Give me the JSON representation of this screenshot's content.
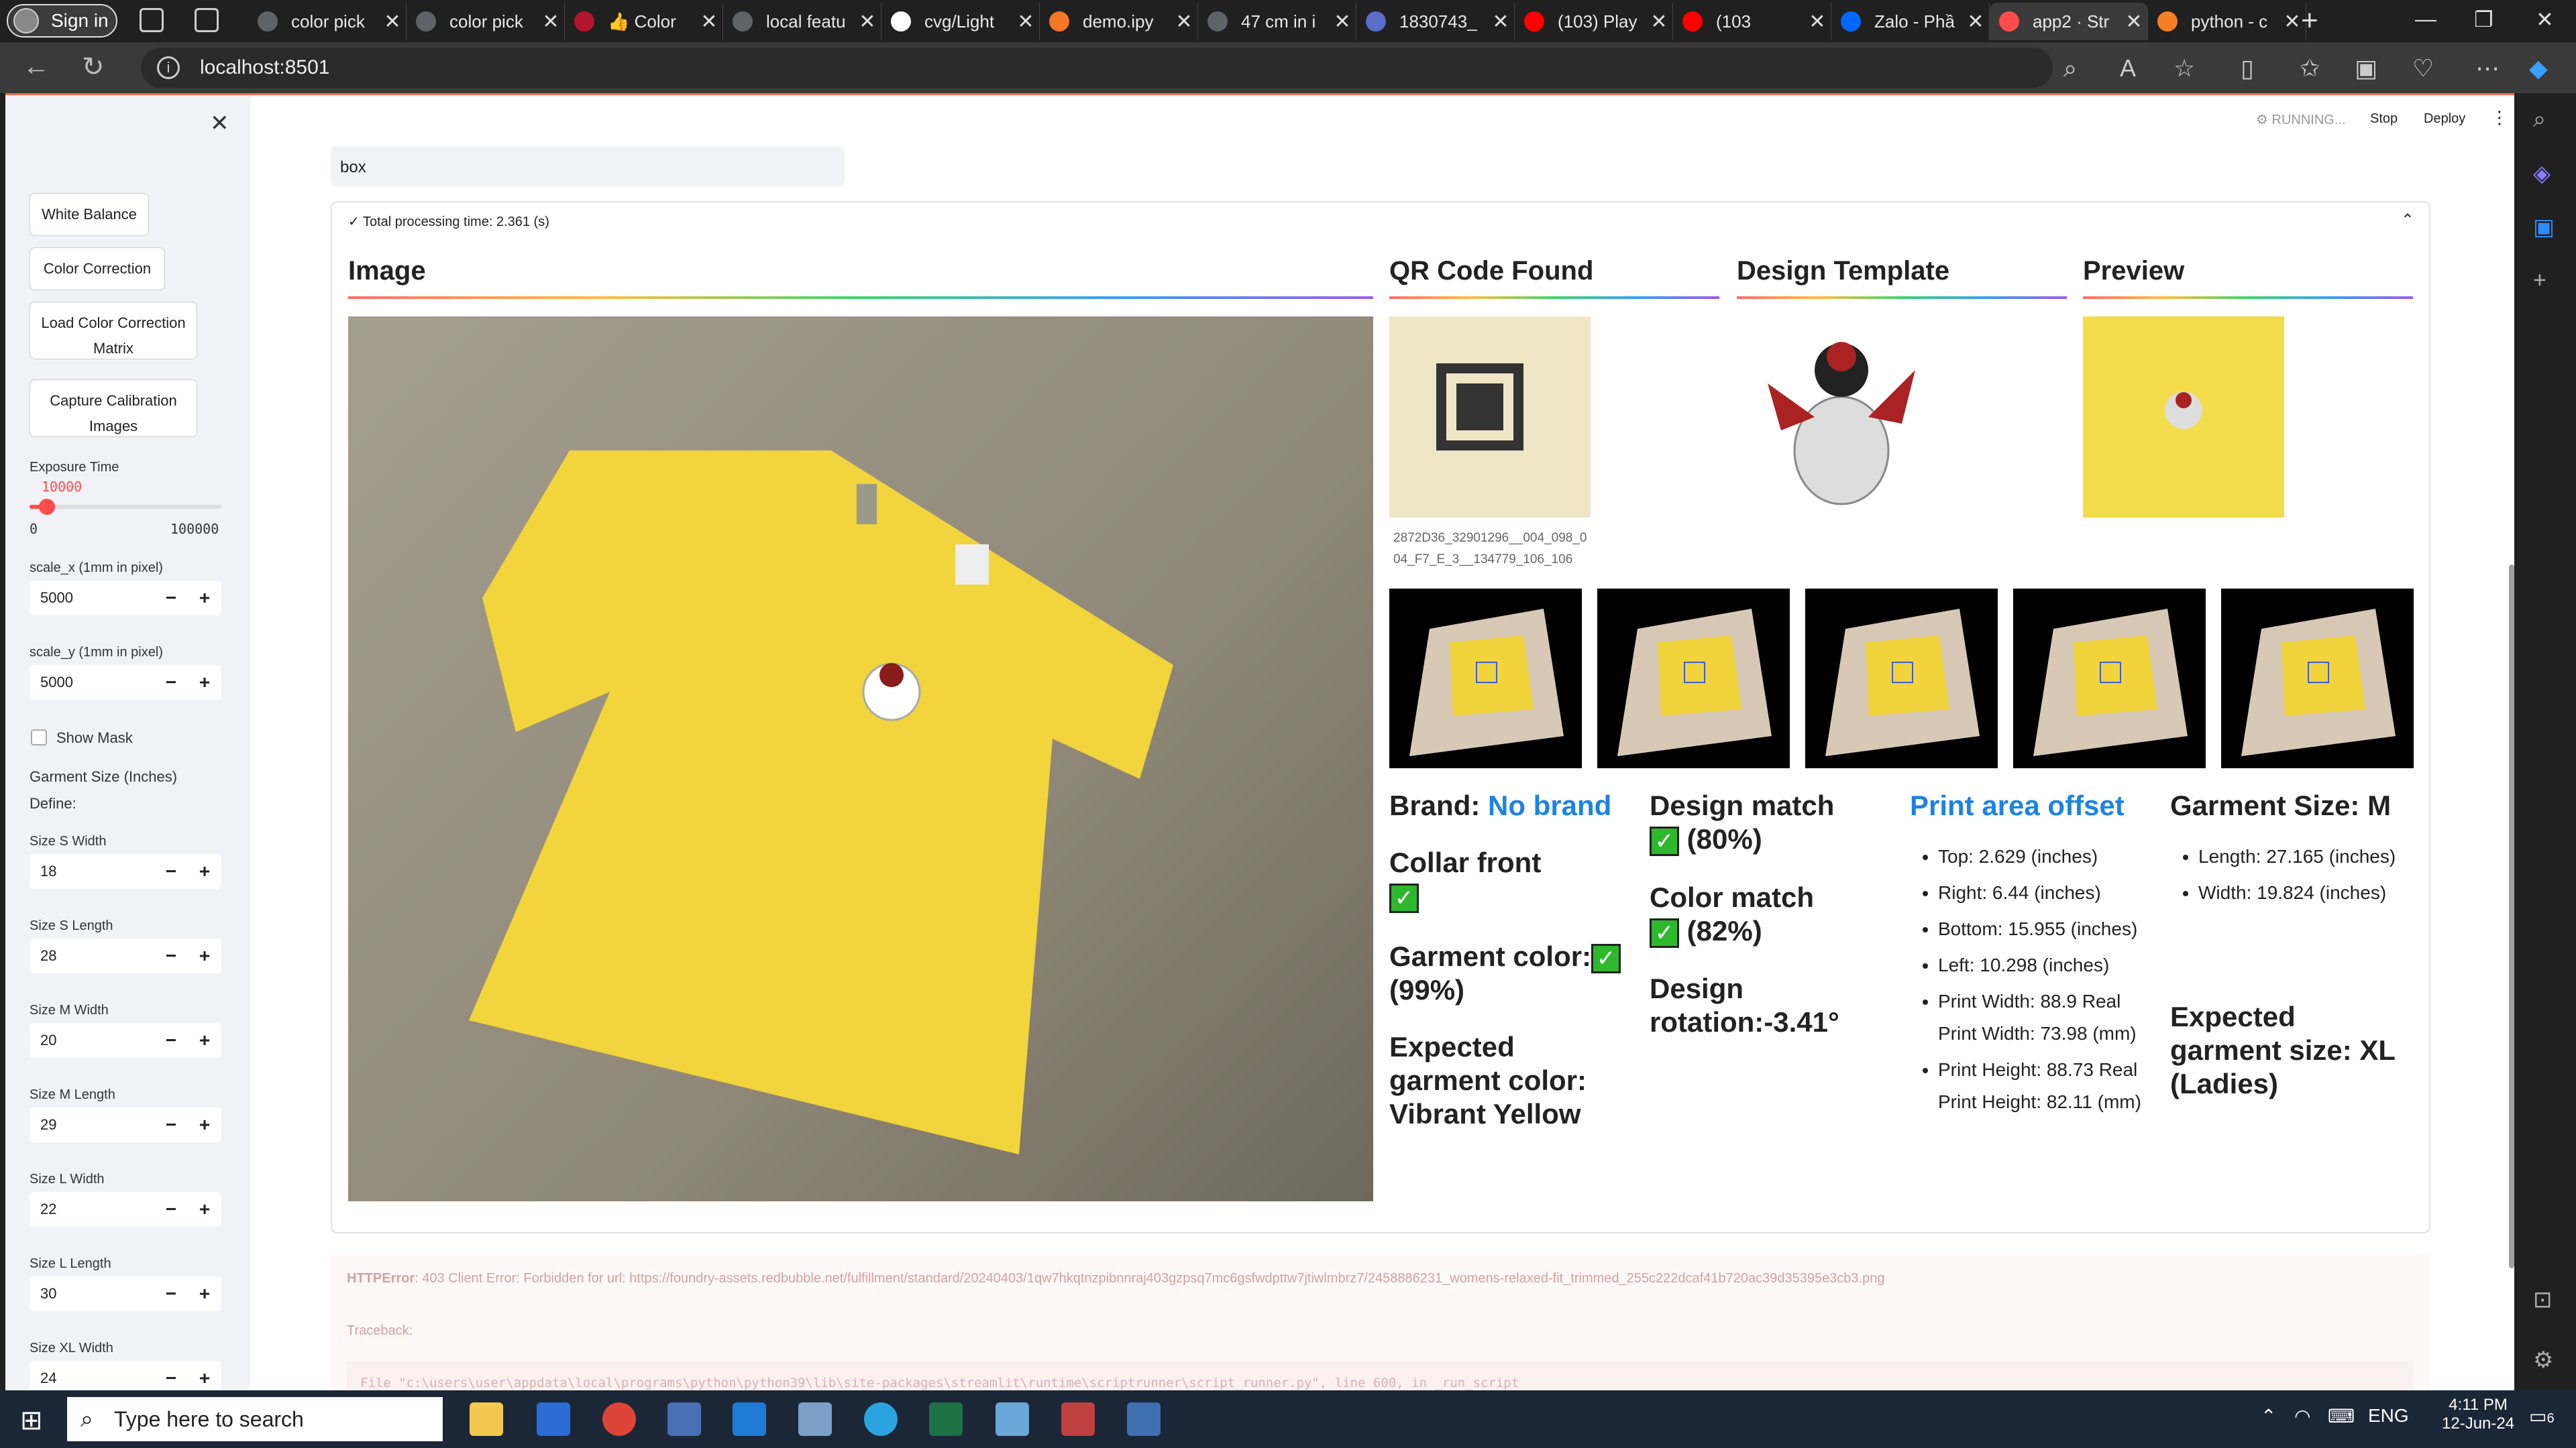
{
  "browser": {
    "signin": "Sign in",
    "tabs": [
      {
        "label": "color pick",
        "color": "#5f6368"
      },
      {
        "label": "color pick",
        "color": "#5f6368"
      },
      {
        "label": "👍 Color",
        "color": "#b3152f"
      },
      {
        "label": "local featu",
        "color": "#5f6368"
      },
      {
        "label": "cvg/Light",
        "color": "#ffffff"
      },
      {
        "label": "demo.ipy",
        "color": "#f37726"
      },
      {
        "label": "47 cm in i",
        "color": "#5f6368"
      },
      {
        "label": "1830743_",
        "color": "#5b6cc9"
      },
      {
        "label": "(103) Play",
        "color": "#ff0000"
      },
      {
        "label": "(103",
        "color": "#ff0000"
      },
      {
        "label": "Zalo - Phầ",
        "color": "#0068ff"
      },
      {
        "label": "app2 · Str",
        "color": "#ff4b4b"
      },
      {
        "label": "python - c",
        "color": "#f48024"
      }
    ],
    "url": "localhost:8501"
  },
  "sidebar": {
    "buttons": [
      "White Balance",
      "Color Correction",
      "Load Color Correction Matrix",
      "Capture Calibration Images"
    ],
    "exposure": {
      "label": "Exposure Time",
      "value": "10000",
      "min": "0",
      "max": "100000"
    },
    "scale_x": {
      "label": "scale_x (1mm in pixel)",
      "value": "5000"
    },
    "scale_y": {
      "label": "scale_y (1mm in pixel)",
      "value": "5000"
    },
    "show_mask": "Show Mask",
    "garment_size_title": "Garment Size (Inches)",
    "define": "Define:",
    "sizes": [
      {
        "label": "Size S Width",
        "value": "18"
      },
      {
        "label": "Size S Length",
        "value": "28"
      },
      {
        "label": "Size M Width",
        "value": "20"
      },
      {
        "label": "Size M Length",
        "value": "29"
      },
      {
        "label": "Size L Width",
        "value": "22"
      },
      {
        "label": "Size L Length",
        "value": "30"
      },
      {
        "label": "Size XL Width",
        "value": "24"
      }
    ]
  },
  "topbar": {
    "running": "RUNNING...",
    "stop": "Stop",
    "deploy": "Deploy"
  },
  "main": {
    "input_value": "box",
    "processing": "Total processing time: 2.361 (s)",
    "headers": {
      "image": "Image",
      "qr": "QR Code Found",
      "design": "Design Template",
      "preview": "Preview"
    },
    "qr_caption": "2872D36_32901296__004_098_004_F7_E_3__134779_106_106",
    "brand_label": "Brand:",
    "brand_value": "No brand",
    "collar": "Collar front",
    "garment_color": "Garment color:",
    "garment_color_pct": "(99%)",
    "expected_color": "Expected garment color: Vibrant Yellow",
    "design_match": "Design match",
    "design_match_pct": "(80%)",
    "color_match": "Color match",
    "color_match_pct": "(82%)",
    "rotation": "Design rotation:-3.41°",
    "print_offset_title": "Print area offset",
    "offsets": [
      "Top: 2.629 (inches)",
      "Right: 6.44 (inches)",
      "Bottom: 15.955 (inches)",
      "Left: 10.298 (inches)",
      "Print Width: 88.9 Real Print Width: 73.98 (mm)",
      "Print Height: 88.73 Real Print Height: 82.11 (mm)"
    ],
    "garment_size_title": "Garment Size: M",
    "garment_dims": [
      "Length: 27.165 (inches)",
      "Width: 19.824 (inches)"
    ],
    "expected_size": "Expected garment size: XL (Ladies)",
    "error_title": "HTTPError",
    "error_msg": ": 403 Client Error: Forbidden for url: https://foundry-assets.redbubble.net/fulfillment/standard/20240403/1qw7hkqtnzpibnnraj403gzpsq7mc6gsfwdpttw7jtiwlmbrz7/2458886231_womens-relaxed-fit_trimmed_255c222dcaf41b720ac39d35395e3cb3.png",
    "traceback": "Traceback:",
    "trace_line": "File \"c:\\users\\user\\appdata\\local\\programs\\python\\python39\\lib\\site-packages\\streamlit\\runtime\\scriptrunner\\script_runner.py\", line 600, in _run_script"
  },
  "taskbar": {
    "search_placeholder": "Type here to search",
    "lang": "ENG",
    "time": "4:11 PM",
    "date": "12-Jun-24",
    "notif": "6"
  }
}
